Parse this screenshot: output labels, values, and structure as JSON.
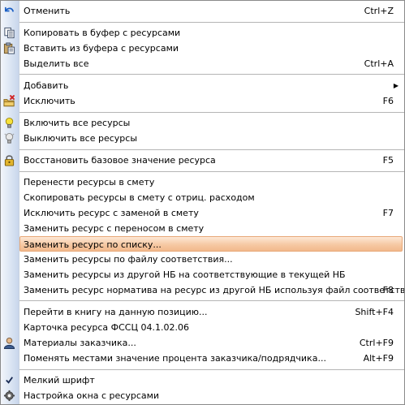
{
  "menu": {
    "items": [
      {
        "label": "Отменить",
        "shortcut": "Ctrl+Z",
        "icon": "undo-icon"
      },
      {
        "label": "Копировать в буфер с ресурсами",
        "shortcut": "",
        "icon": "copy-icon"
      },
      {
        "label": "Вставить из буфера с ресурсами",
        "shortcut": "",
        "icon": "paste-icon"
      },
      {
        "label": "Выделить все",
        "shortcut": "Ctrl+A",
        "icon": ""
      },
      {
        "label": "Добавить",
        "shortcut": "",
        "icon": "",
        "submenu": true
      },
      {
        "label": "Исключить",
        "shortcut": "F6",
        "icon": "exclude-icon"
      },
      {
        "label": "Включить все ресурсы",
        "shortcut": "",
        "icon": "bulb-on-icon"
      },
      {
        "label": "Выключить все ресурсы",
        "shortcut": "",
        "icon": "bulb-off-icon"
      },
      {
        "label": "Восстановить базовое значение ресурса",
        "shortcut": "F5",
        "icon": "lock-icon"
      },
      {
        "label": "Перенести ресурсы в смету",
        "shortcut": "",
        "icon": ""
      },
      {
        "label": "Скопировать ресурсы в смету с отриц. расходом",
        "shortcut": "",
        "icon": ""
      },
      {
        "label": "Исключить ресурс с заменой в смету",
        "shortcut": "F7",
        "icon": ""
      },
      {
        "label": "Заменить ресурс с переносом в смету",
        "shortcut": "",
        "icon": ""
      },
      {
        "label": "Заменить ресурс по списку...",
        "shortcut": "",
        "icon": "",
        "highlighted": true
      },
      {
        "label": "Заменить ресурсы по файлу соответствия...",
        "shortcut": "",
        "icon": ""
      },
      {
        "label": "Заменить ресурсы из другой НБ на соответствующие в текущей НБ",
        "shortcut": "",
        "icon": ""
      },
      {
        "label": "Заменить ресурс норматива на ресурс из другой НБ используя файл соответствия...",
        "shortcut": "F8",
        "icon": ""
      },
      {
        "label": "Перейти в книгу на данную позицию...",
        "shortcut": "Shift+F4",
        "icon": ""
      },
      {
        "label": "Карточка ресурса ФССЦ 04.1.02.06",
        "shortcut": "",
        "icon": ""
      },
      {
        "label": "Материалы заказчика...",
        "shortcut": "Ctrl+F9",
        "icon": "person-icon"
      },
      {
        "label": "Поменять местами значение процента заказчика/подрядчика...",
        "shortcut": "Alt+F9",
        "icon": ""
      },
      {
        "label": "Мелкий шрифт",
        "shortcut": "",
        "icon": "checkmark-icon"
      },
      {
        "label": "Настройка окна с ресурсами",
        "shortcut": "",
        "icon": "gear-icon"
      }
    ]
  },
  "colors": {
    "highlight": "#f6c9a4",
    "gutter": "#dbe5f3",
    "separator": "#b5b5b5"
  }
}
